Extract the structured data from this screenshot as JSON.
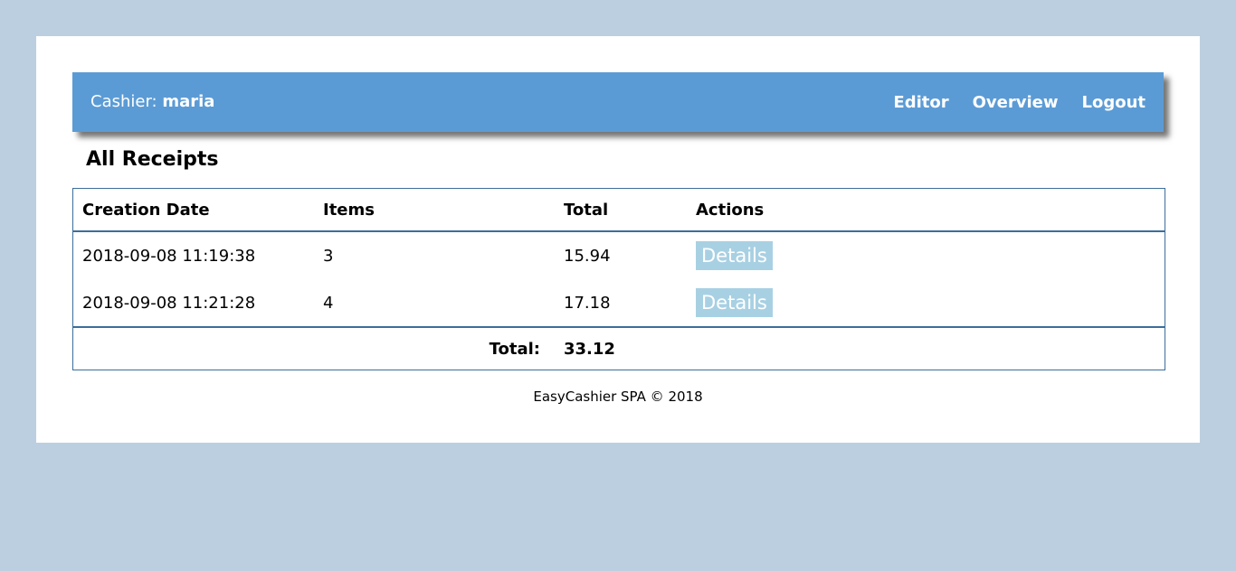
{
  "navbar": {
    "cashier_label": "Cashier:",
    "cashier_name": "maria",
    "links": [
      "Editor",
      "Overview",
      "Logout"
    ]
  },
  "page": {
    "title": "All Receipts"
  },
  "table": {
    "columns": [
      "Creation Date",
      "Items",
      "Total",
      "Actions"
    ],
    "rows": [
      {
        "date": "2018-09-08 11:19:38",
        "items": "3",
        "total": "15.94",
        "action": "Details"
      },
      {
        "date": "2018-09-08 11:21:28",
        "items": "4",
        "total": "17.18",
        "action": "Details"
      }
    ],
    "footer": {
      "label": "Total:",
      "value": "33.12"
    }
  },
  "footer": {
    "text": "EasyCashier SPA © 2018"
  },
  "colors": {
    "background": "#bccfe0",
    "navbar": "#5b9bd5",
    "button": "#a8d0e3",
    "table_border": "#3c6e9a"
  }
}
